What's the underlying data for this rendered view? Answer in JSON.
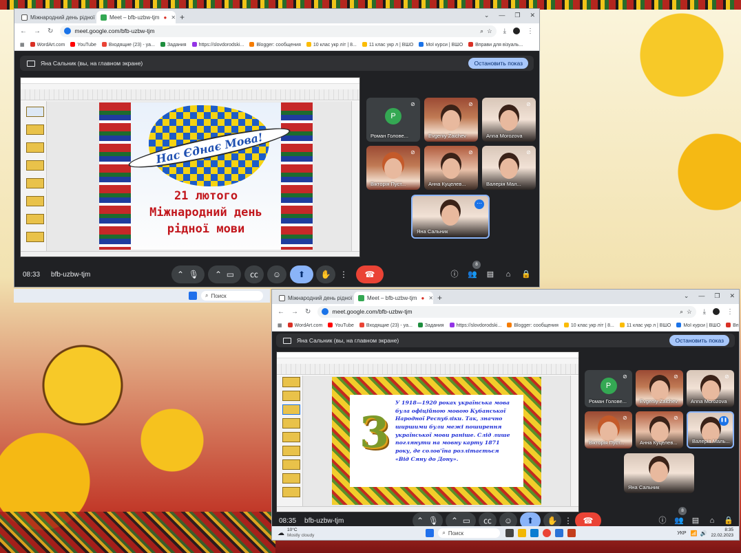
{
  "common": {
    "tab1_title": "Міжнародний день рідної мо",
    "tab2_title": "Meet – bfb-uzbw-tjm",
    "url": "meet.google.com/bfb-uzbw-tjm",
    "presenter_label": "Яна Сальник (вы, на главном экране)",
    "stop_button": "Остановить показ",
    "meeting_code": "bfb-uzbw-tjm",
    "bookmarks": [
      "WordArt.com",
      "YouTube",
      "Входящие (23) - ya...",
      "Задания",
      "https://slovdorodski...",
      "Blogger: сообщения",
      "10 клас укр літ | 8...",
      "11 клас укр л | ВШО",
      "Мої курси | ВШО",
      "Вправи для візуаль..."
    ],
    "participants_count": "8",
    "search_label": "Поиск",
    "brand_color": "#1a73e8",
    "end_call_color": "#ea4335"
  },
  "window1": {
    "time": "08:33",
    "slide": {
      "banner": "Нас Єднає Мова!",
      "line1": "21 лютого",
      "line2": "Міжнародний день",
      "line3": "рідної мови"
    },
    "participants": [
      {
        "name": "Роман Голове...",
        "avatar": "Р"
      },
      {
        "name": "Evgeniy Zaichev"
      },
      {
        "name": "Anna Morozova"
      },
      {
        "name": "Вікторія Пуст..."
      },
      {
        "name": "Анна Куцелев..."
      },
      {
        "name": "Валерія Мал..."
      },
      {
        "name": "Яна Сальник"
      }
    ]
  },
  "window2": {
    "time": "08:35",
    "slide": {
      "number": "3",
      "text": "У 1918—1920 роках українська мова була офіційною мовою Кубанської Народної Республіки. Так, значно ширшими були межі поширення української мови раніше. Слід лише поглянути на мовну карту 1871 року, де солов'їна розлітається «Від Сяну до Дону»."
    },
    "participants": [
      {
        "name": "Роман Голове...",
        "avatar": "Р"
      },
      {
        "name": "Evgeniy Zaichev"
      },
      {
        "name": "Anna Morozova"
      },
      {
        "name": "Вікторія Пуст..."
      },
      {
        "name": "Анна Куцелев..."
      },
      {
        "name": "Валерія Маль..."
      },
      {
        "name": "Яна Сальник"
      }
    ],
    "taskbar": {
      "weather_temp": "10°C",
      "weather_desc": "Mostly cloudy",
      "lang": "УКР",
      "clock_time": "8:35",
      "clock_date": "22.02.2023"
    }
  }
}
